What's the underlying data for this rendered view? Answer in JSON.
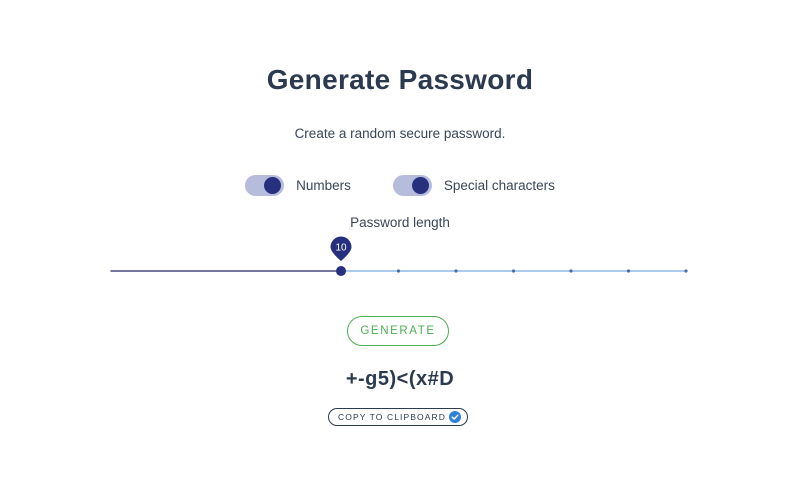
{
  "page": {
    "title": "Generate Password",
    "subtitle": "Create a random secure password."
  },
  "options": [
    {
      "label": "Numbers",
      "enabled": true
    },
    {
      "label": "Special characters",
      "enabled": true
    }
  ],
  "length": {
    "label": "Password length",
    "value": 10,
    "value_text": "10",
    "min": 6,
    "max": 16,
    "step": 1
  },
  "actions": {
    "generate_label": "GENERATE",
    "copy_label": "COPY TO CLIPBOARD",
    "copy_icon": "check-circle-icon"
  },
  "result": {
    "password": "+-g5)<(x#D"
  },
  "colors": {
    "title": "#2b3a4f",
    "toggle_track": "#b6bcdc",
    "toggle_knob": "#27307e",
    "slider_active": "#4a4a7c",
    "slider_inactive": "#8fb8e8",
    "slider_thumb": "#27307e",
    "generate": "#4caf50",
    "copy_check": "#2f80d8"
  }
}
